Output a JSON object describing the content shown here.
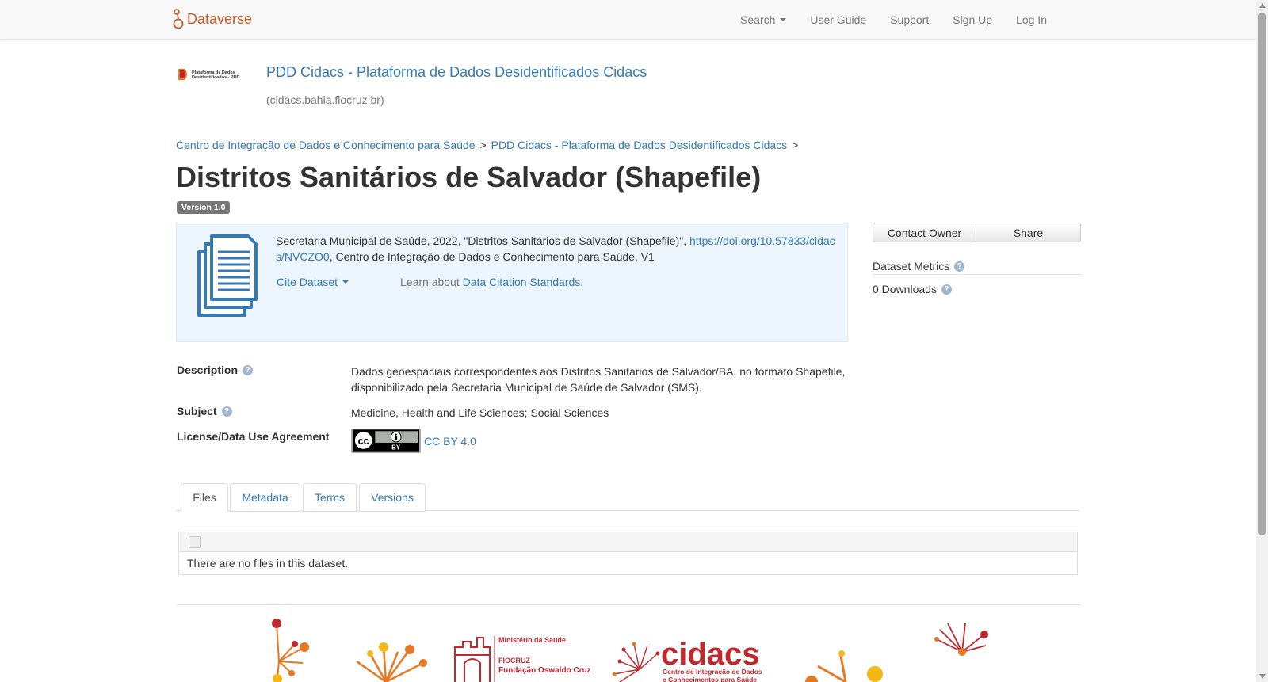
{
  "nav": {
    "brand": "Dataverse",
    "search": "Search",
    "user_guide": "User Guide",
    "support": "Support",
    "sign_up": "Sign Up",
    "log_in": "Log In"
  },
  "dataverse": {
    "logo_text_line1": "Plataforma de Dados",
    "logo_text_line2": "Desidentificados - PDD",
    "name": "PDD Cidacs - Plataforma de Dados Desidentificados Cidacs",
    "affiliation": "(cidacs.bahia.fiocruz.br)"
  },
  "breadcrumb": {
    "items": [
      "Centro de Integração de Dados e Conhecimento para Saúde",
      "PDD Cidacs - Plataforma de Dados Desidentificados Cidacs"
    ],
    "separator": ">"
  },
  "dataset": {
    "title": "Distritos Sanitários de Salvador (Shapefile)",
    "version": "Version 1.0"
  },
  "citation": {
    "text_before": "Secretaria Municipal de Saúde, 2022, \"Distritos Sanitários de Salvador (Shapefile)\", ",
    "doi": "https://doi.org/10.57833/cidacs/NVCZO0",
    "text_after": ", Centro de Integração de Dados e Conhecimento para Saúde, V1",
    "cite_dataset": "Cite Dataset",
    "learn_about": "Learn about ",
    "standards_link": "Data Citation Standards."
  },
  "actions": {
    "contact_owner": "Contact Owner",
    "share": "Share"
  },
  "metrics": {
    "label": "Dataset Metrics",
    "downloads": "0 Downloads"
  },
  "metadata": {
    "description_label": "Description",
    "description_value": "Dados geoespaciais correspondentes aos Distritos Sanitários de Salvador/BA, no formato Shapefile, disponibilizado pela Secretaria Municipal de Saúde de Salvador (SMS).",
    "subject_label": "Subject",
    "subject_value": "Medicine, Health and Life Sciences; Social Sciences",
    "license_label": "License/Data Use Agreement",
    "license_value": "CC BY 4.0",
    "cc_badge_text": "BY"
  },
  "tabs": [
    "Files",
    "Metadata",
    "Terms",
    "Versions"
  ],
  "files": {
    "empty_message": "There are no files in this dataset."
  },
  "footer": {
    "ministry": "Ministério da Saúde",
    "fiocruz": "FIOCRUZ",
    "fundacao": "Fundação Oswaldo Cruz",
    "cidacs": "cidacs",
    "cidacs_sub1": "Centro de Integração de Dados",
    "cidacs_sub2": "e Conhecimentos para Saúde"
  },
  "colors": {
    "brand": "#c55b28",
    "link": "#337ab7",
    "citation_bg": "#edf5fc",
    "footer_red": "#c0282d",
    "footer_orange": "#e87722",
    "footer_yellow": "#f3b816"
  }
}
